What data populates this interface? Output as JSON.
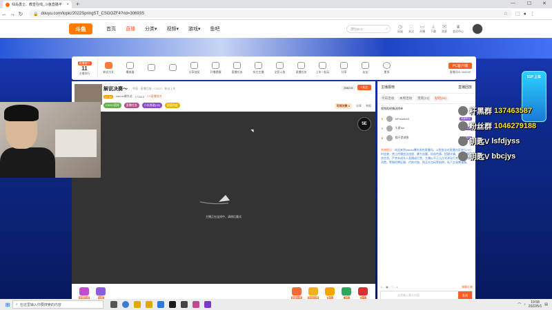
{
  "browser": {
    "tab_title": "仙岛勇士、教皇在线_斗鱼直播平",
    "url": "douyu.com/topic/2022SpringST_CSGOZF4?rid=30693S"
  },
  "header": {
    "logo_text": "斗鱼",
    "nav": [
      {
        "label": "首页",
        "active": false
      },
      {
        "label": "直播",
        "active": true
      },
      {
        "label": "分类▾",
        "active": false
      },
      {
        "label": "视频▾",
        "active": false
      },
      {
        "label": "游戏▾",
        "active": false
      },
      {
        "label": "鱼吧",
        "active": false
      }
    ],
    "search_placeholder": "搜Nsico",
    "icons": [
      "历史",
      "关注",
      "开播",
      "下载",
      "消息",
      "会员中心"
    ]
  },
  "toolbar": {
    "rank_tag": "直播排行",
    "rank_num": "11",
    "rank_label": "主播排行",
    "items": [
      "粉丝大礼",
      "播放器",
      "",
      "",
      "分享抽奖",
      "开播提醒",
      "直播任务",
      "实力主播",
      "全民斗鱼",
      "直播任务",
      "上车一起玩",
      "分享",
      "友友",
      "更多"
    ],
    "pc_button": "PC客户端",
    "pc_sub": "直播间ID 30693S"
  },
  "room": {
    "title": "解说决赛～",
    "meta": "举报 · 直播回放 · CSGO · 粉丝上车",
    "level": "LV 86",
    "streamer": "sakula爆炸虎",
    "heat": "171819",
    "ranking": "CS直播排名",
    "medals": [
      "CSGO奖杯",
      "直播任务",
      "小队频道(18)",
      "超级热度"
    ],
    "tags_colors": [
      "#66b04c",
      "#c04a8e",
      "#8a4ac8",
      "#e5b400"
    ],
    "follow_count": "356216",
    "follow_label": "+关注",
    "chance_label": "可领次数",
    "chance_count": "1",
    "share": "分享",
    "report": "举报"
  },
  "player": {
    "logo": "5E",
    "error": "主播正在连线中，请稍后重试"
  },
  "gift_bar": {
    "gifts": [
      "惊喜礼物",
      "火箭",
      "超级火箭",
      "粉丝灯牌",
      "鱼丸",
      "飞机",
      "办卡"
    ],
    "gift_colors": [
      "#c54cd0",
      "#8f5ae0",
      "#f06b35",
      "#f0b020",
      "#f5a400",
      "#2fa65c",
      "#d1342f"
    ]
  },
  "chat": {
    "top_left": "主播报榜",
    "top_right": "直播回放",
    "tabs": [
      "今日活动",
      "本周活动",
      "贵宾(13)",
      "贴吧(55)"
    ],
    "sub": "视频贴吧播送榜单",
    "ranks": [
      {
        "name": "fuFaturars0",
        "badge": "超级粉丝"
      },
      {
        "name": "头星tun",
        "badge": "超级粉丝"
      },
      {
        "name": "猫不是咸鱼",
        "badge": "超级粉丝"
      }
    ],
    "sys_prefix": "系统提示：",
    "sys_message": "欢迎来到sakula爆炸虎的直播间。斗鱼依法对直播内容进行24小时巡查，禁止传播违法违规、暴力血腥、低俗色情、招嫖诈骗、违禁品等不良信息。严禁未成年人直播或打赏，主播以不正当方式诱导打赏，注意理性消费。警惕招聘征婚、代练代抽、购买礼包码等陷阱，私下交易需谨慎。",
    "input_placeholder": "这里输入聊天内容",
    "send": "发送",
    "tool_right": "弹幕礼物"
  },
  "overlay": {
    "rows": [
      {
        "k": "杆黑群",
        "v": "137463587"
      },
      {
        "k": "粉丝群",
        "v": "1046279188"
      },
      {
        "k": "钥匙V",
        "v": "lsfdjyss"
      },
      {
        "k": "钥匙V",
        "v": "bbcjys"
      }
    ],
    "badge": "51P 上车"
  },
  "taskbar": {
    "search_placeholder": "在这里输入你要搜索的内容",
    "time": "19:58",
    "date": "2022/5/1",
    "app_colors": [
      "#555",
      "#3a7bd5",
      "#e0a800",
      "#e0a800",
      "#2b7bd9",
      "#1a1a1a",
      "#444",
      "#c04a8e",
      "#7a3ac8"
    ]
  }
}
